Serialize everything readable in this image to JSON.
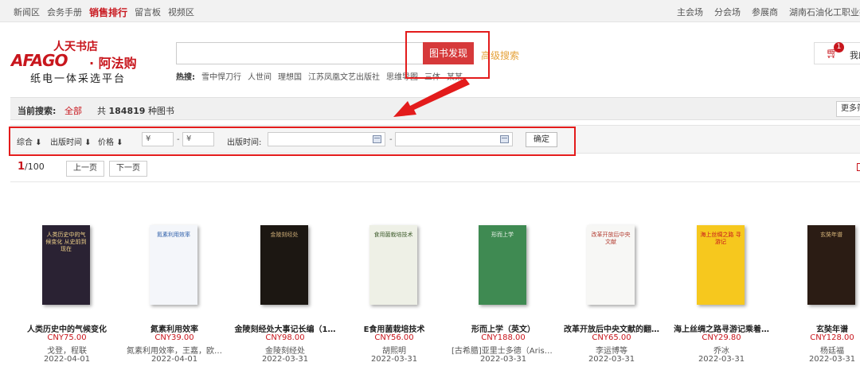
{
  "topnav": {
    "left": [
      {
        "label": "新闻区",
        "active": false
      },
      {
        "label": "会务手册",
        "active": false
      },
      {
        "label": "销售排行",
        "active": true
      },
      {
        "label": "留言板",
        "active": false
      },
      {
        "label": "视频区",
        "active": false
      }
    ],
    "right": [
      "主会场",
      "分会场",
      "参展商",
      "湖南石油化工职业技"
    ]
  },
  "logo": {
    "store_name": "人天书店",
    "brand": "AFAGO",
    "brand_cn": "· 阿法购",
    "slogan": "纸电一体采选平台"
  },
  "search": {
    "value": "",
    "button_label": "图书发现",
    "advanced_label": "高级搜索",
    "hot_label": "热搜:",
    "hot_terms": [
      "雪中悍刀行",
      "人世间",
      "理想国",
      "江苏凤凰文艺出版社",
      "思维导图",
      "三体",
      "某某"
    ]
  },
  "cart": {
    "icon": "cart-icon",
    "badge": "1",
    "label": "我的"
  },
  "current_search": {
    "label": "当前搜索:",
    "all_label": "全部",
    "count_prefix": "共",
    "count": "184819",
    "count_suffix": "种图书",
    "more_label": "更多筛选"
  },
  "filters": {
    "sort_options": [
      "综合 ⬇",
      "出版时间 ⬇",
      "价格 ⬇"
    ],
    "price_min_placeholder": "¥",
    "price_max_placeholder": "¥",
    "dash": "-",
    "date_label": "出版时间:",
    "date_start": "",
    "date_end": "",
    "confirm_label": "确定"
  },
  "pager": {
    "current": "1",
    "total": "/100",
    "prev_label": "上一页",
    "next_label": "下一页"
  },
  "books": [
    {
      "title": "人类历史中的气候变化",
      "price": "CNY75.00",
      "author": "戈登，程联",
      "date": "2022-04-01",
      "cover_bg": "#2a2233",
      "cover_fg": "#f0d28a",
      "cover_text": "人类历史中的气候变化 从史前到现在"
    },
    {
      "title": "氮素利用效率",
      "price": "CNY39.00",
      "author": "氮素利用效率，王嘉，欧…",
      "date": "2022-04-01",
      "cover_bg": "#f4f6fa",
      "cover_fg": "#2a5ca8",
      "cover_text": "氮素利用效率"
    },
    {
      "title": "金陵刻经处大事记长编（1…",
      "price": "CNY98.00",
      "author": "金陵刻经处",
      "date": "2022-03-31",
      "cover_bg": "#1c1712",
      "cover_fg": "#c8a874",
      "cover_text": "金陵刻经处"
    },
    {
      "title": "E食用菌栽培技术",
      "price": "CNY56.00",
      "author": "胡熙明",
      "date": "2022-03-31",
      "cover_bg": "#eef0e6",
      "cover_fg": "#3c5a2a",
      "cover_text": "食用菌栽培技术"
    },
    {
      "title": "形而上学（英文）",
      "price": "CNY188.00",
      "author": "[古希腊]亚里士多德（Arist…",
      "date": "2022-03-31",
      "cover_bg": "#3f8a52",
      "cover_fg": "#e8f2e8",
      "cover_text": "形而上学"
    },
    {
      "title": "改革开放后中央文献的翻…",
      "price": "CNY65.00",
      "author": "李运博等",
      "date": "2022-03-31",
      "cover_bg": "#f7f7f5",
      "cover_fg": "#b23a2e",
      "cover_text": "改革开放后中央文献"
    },
    {
      "title": "海上丝绸之路寻游记乘着…",
      "price": "CNY29.80",
      "author": "乔冰",
      "date": "2022-03-31",
      "cover_bg": "#f6c81e",
      "cover_fg": "#c8161d",
      "cover_text": "海上丝绸之路 寻游记"
    },
    {
      "title": "玄奘年谱",
      "price": "CNY128.00",
      "author": "杨廷福",
      "date": "2022-03-31",
      "cover_bg": "#2b1c14",
      "cover_fg": "#d8b67a",
      "cover_text": "玄奘年谱"
    }
  ]
}
